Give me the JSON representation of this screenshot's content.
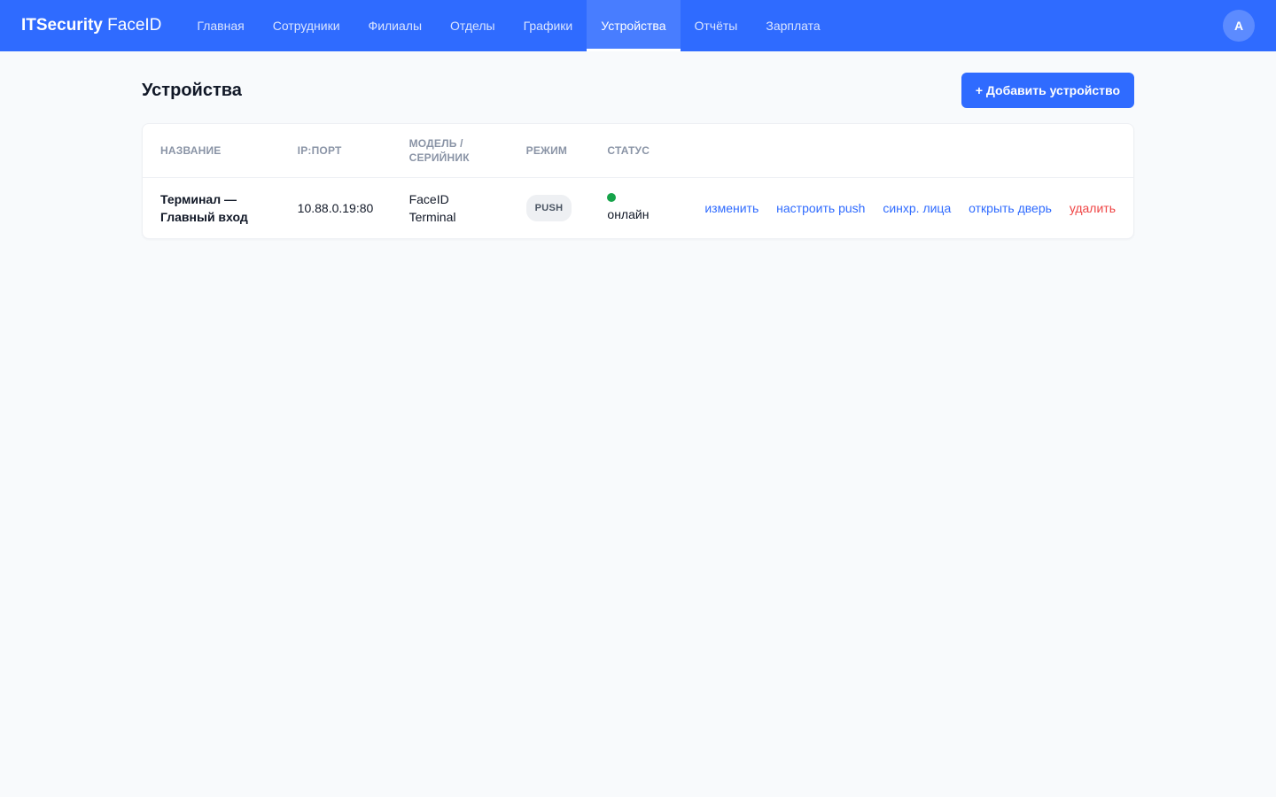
{
  "header": {
    "brand_strong": "ITSecurity",
    "brand_rest": "FaceID",
    "nav": [
      {
        "label": "Главная"
      },
      {
        "label": "Сотрудники"
      },
      {
        "label": "Филиалы"
      },
      {
        "label": "Отделы"
      },
      {
        "label": "Графики"
      },
      {
        "label": "Устройства",
        "active": true
      },
      {
        "label": "Отчёты"
      },
      {
        "label": "Зарплата"
      }
    ],
    "avatar_initial": "A"
  },
  "page": {
    "title": "Устройства",
    "add_button_label": "+ Добавить устройство"
  },
  "table": {
    "columns": [
      "Название",
      "IP:порт",
      "Модель / серийник",
      "Режим",
      "Статус"
    ],
    "rows": [
      {
        "name": "Терминал — Главный вход",
        "ip_port": "10.88.0.19:80",
        "model": "FaceID Terminal",
        "mode": "PUSH",
        "status": "онлайн",
        "actions": {
          "edit": "изменить",
          "configure_push": "настроить push",
          "sync_faces": "синхр. лица",
          "open_door": "открыть дверь",
          "delete": "удалить"
        }
      }
    ]
  },
  "colors": {
    "primary": "#2f6bff",
    "online": "#16a34a",
    "danger": "#ef4444"
  }
}
